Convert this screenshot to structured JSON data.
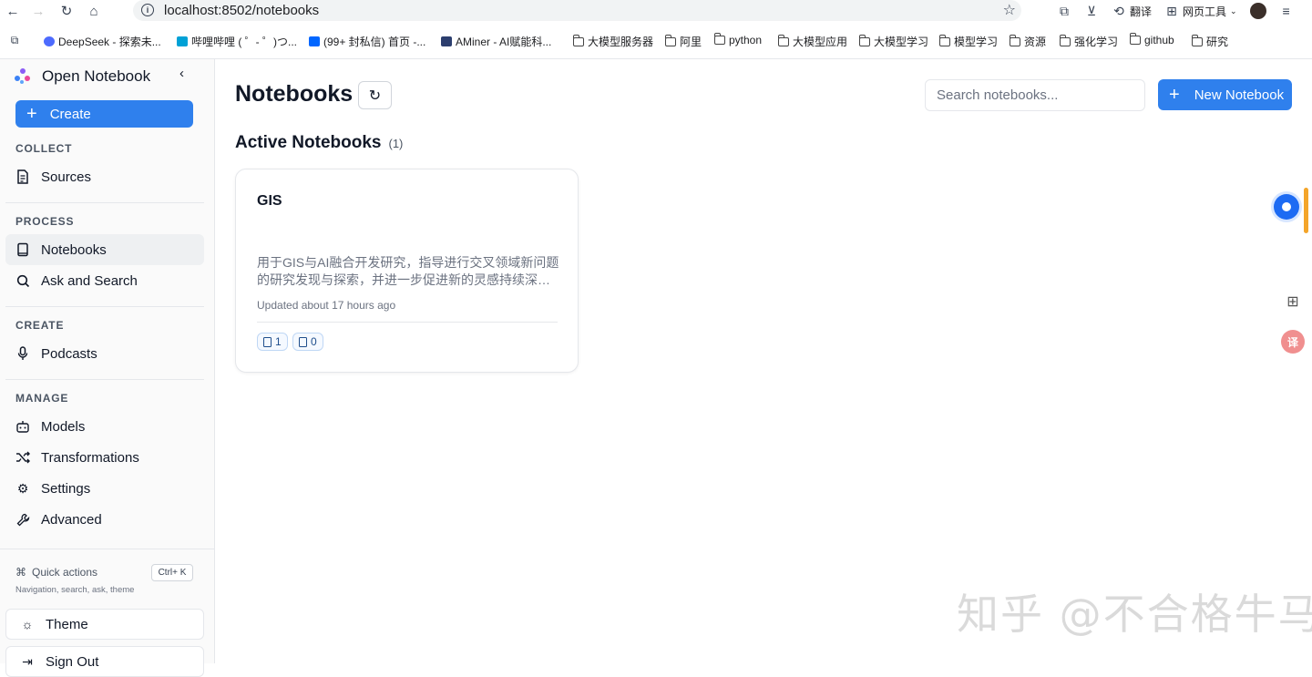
{
  "browser": {
    "url": "localhost:8502/notebooks",
    "translate_label": "翻译",
    "tools_label": "网页工具"
  },
  "bookmarks": [
    {
      "label": "DeepSeek - 探索未...",
      "kind": "site",
      "color": "#4d6bfe"
    },
    {
      "label": "哔哩哔哩 ( ゜- ゜)つ...",
      "kind": "site",
      "color": "#00a1d6"
    },
    {
      "label": "(99+ 封私信) 首页 -...",
      "kind": "site",
      "color": "#0066ff"
    },
    {
      "label": "AMiner - AI赋能科...",
      "kind": "site",
      "color": "#2c3e6e"
    },
    {
      "label": "大模型服务器",
      "kind": "folder"
    },
    {
      "label": "阿里",
      "kind": "folder"
    },
    {
      "label": "python",
      "kind": "folder"
    },
    {
      "label": "大模型应用",
      "kind": "folder"
    },
    {
      "label": "大模型学习",
      "kind": "folder"
    },
    {
      "label": "模型学习",
      "kind": "folder"
    },
    {
      "label": "资源",
      "kind": "folder"
    },
    {
      "label": "强化学习",
      "kind": "folder"
    },
    {
      "label": "github",
      "kind": "folder"
    },
    {
      "label": "研究",
      "kind": "folder"
    }
  ],
  "sidebar": {
    "brand": "Open Notebook",
    "create_label": "Create",
    "sections": {
      "collect": "COLLECT",
      "process": "PROCESS",
      "create": "CREATE",
      "manage": "MANAGE"
    },
    "items": {
      "sources": "Sources",
      "notebooks": "Notebooks",
      "ask": "Ask and Search",
      "podcasts": "Podcasts",
      "models": "Models",
      "transformations": "Transformations",
      "settings": "Settings",
      "advanced": "Advanced"
    },
    "quick_actions": "Quick actions",
    "quick_shortcut": "Ctrl+ K",
    "quick_sub": "Navigation, search, ask, theme",
    "theme": "Theme",
    "sign_out": "Sign Out"
  },
  "main": {
    "title": "Notebooks",
    "search_placeholder": "Search notebooks...",
    "new_notebook": "New Notebook",
    "section_title": "Active Notebooks",
    "section_count": "(1)",
    "notebooks": [
      {
        "title": "GIS",
        "description": "用于GIS与AI融合开发研究，指导进行交叉领域新问题的研究发现与探索，并进一步促进新的灵感持续深入挖掘...",
        "updated": "Updated about 17 hours ago",
        "sources": "1",
        "notes": "0"
      }
    ]
  },
  "watermark": "知乎 @不合格牛马",
  "colors": {
    "accent": "#2f80ed"
  }
}
